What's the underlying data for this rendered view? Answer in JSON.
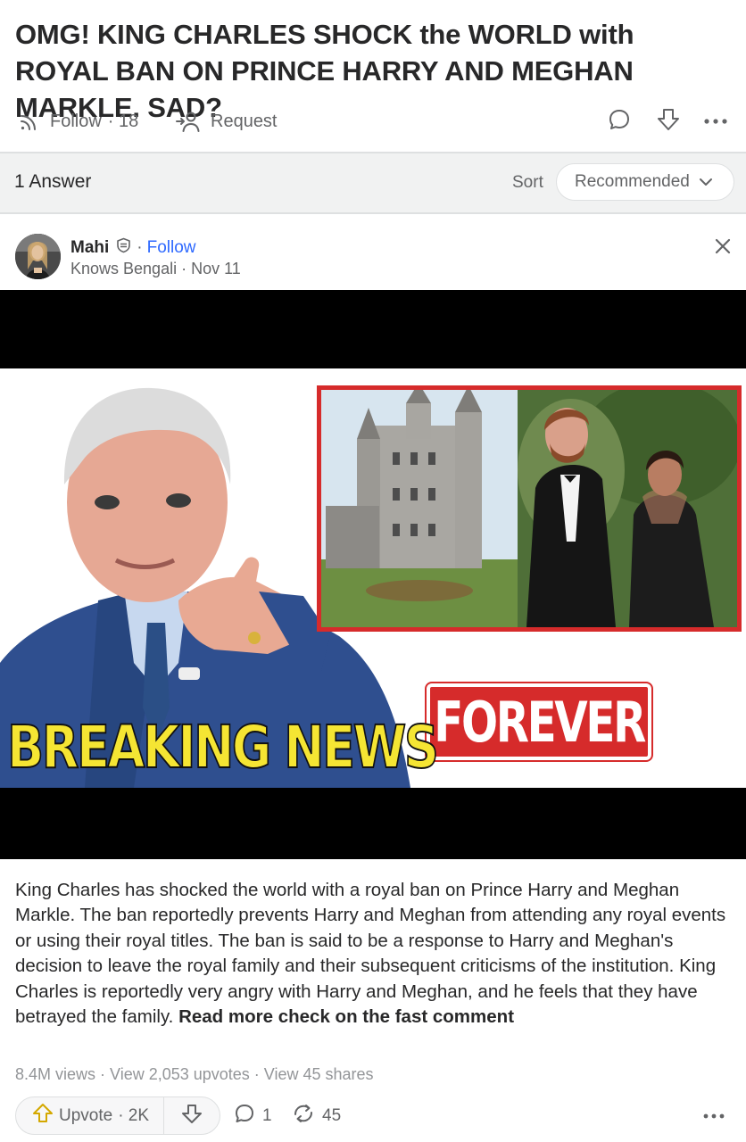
{
  "question": {
    "title": "OMG! KING CHARLES SHOCK the WORLD with ROYAL BAN ON PRINCE HARRY AND MEGHAN MARKLE. SAD?",
    "follow_label": "Follow",
    "follow_count": "· 18",
    "request_label": "Request"
  },
  "answers_bar": {
    "count_label": "1 Answer",
    "sort_label": "Sort",
    "sort_value": "Recommended"
  },
  "answer": {
    "author_name": "Mahi",
    "follow_link": "Follow",
    "author_meta": "Knows Bengali · Nov 11",
    "image_text": {
      "headline": "BREAKING NEWS",
      "tag": "FOREVER"
    },
    "body_text": "King Charles has shocked the world with a royal ban on Prince Harry and Meghan Markle. The ban reportedly prevents Harry and Meghan from attending any royal events or using their royal titles. The ban is said to be a response to Harry and Meghan's decision to leave the royal family and their subsequent criticisms of the institution. King Charles is reportedly very angry with Harry and Meghan, and he feels that they have betrayed the family. ",
    "body_strong": "Read more check on the fast comment",
    "stats": "8.4M views · View 2,053 upvotes · View 45 shares",
    "upvote_label": "Upvote",
    "upvote_count": "· 2K",
    "comment_count": "1",
    "share_count": "45"
  },
  "icons": {
    "follow": "rss-icon",
    "request": "add-person-icon",
    "comment": "speech-bubble-icon",
    "downvote": "down-arrow-icon",
    "more": "ellipsis-icon",
    "badge": "shield-badge-icon",
    "close": "close-icon",
    "upvote": "up-arrow-icon",
    "share": "reshare-icon",
    "chevron": "chevron-down-icon"
  },
  "colors": {
    "text": "#282829",
    "muted": "#636466",
    "link": "#2e69ff",
    "divider": "#dee0e1",
    "section_bg": "#f1f2f2",
    "upvote_accent": "#d4a800",
    "thumb_yellow": "#f5e533",
    "thumb_red": "#d62b2b"
  }
}
